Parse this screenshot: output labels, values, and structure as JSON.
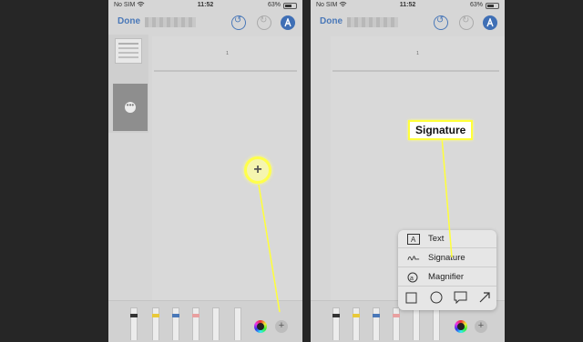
{
  "status": {
    "carrier": "No SIM",
    "time": "11:52",
    "battery": "63%"
  },
  "nav": {
    "done_label": "Done"
  },
  "page": {
    "number": "1"
  },
  "left": {
    "plus_glyph": "+"
  },
  "popup": {
    "items": [
      {
        "label": "Text",
        "icon": "text-box-icon"
      },
      {
        "label": "Signature",
        "icon": "signature-icon"
      },
      {
        "label": "Magnifier",
        "icon": "magnifier-icon"
      }
    ],
    "shapes": [
      "square-icon",
      "circle-icon",
      "speech-bubble-icon",
      "arrow-icon"
    ]
  },
  "callout": {
    "label": "Signature"
  },
  "colors": {
    "accent": "#3f6fb5",
    "highlight": "#ffff3a"
  }
}
